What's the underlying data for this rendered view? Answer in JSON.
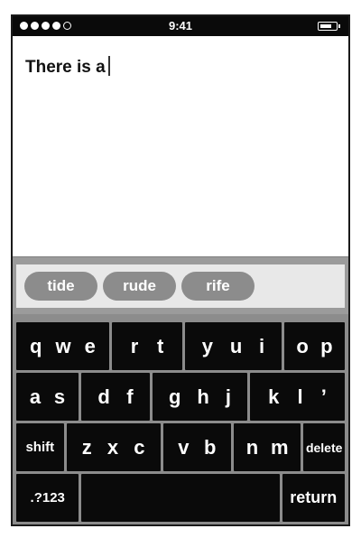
{
  "status": {
    "time": "9:41"
  },
  "editor": {
    "text": "There is a"
  },
  "suggestions": [
    "tide",
    "rude",
    "rife"
  ],
  "keyboard": {
    "row1": [
      [
        "q",
        "w",
        "e"
      ],
      [
        "r",
        "t"
      ],
      [
        "y",
        "u",
        "i"
      ],
      [
        "o",
        "p"
      ]
    ],
    "row2": [
      [
        "a",
        "s"
      ],
      [
        "d",
        "f"
      ],
      [
        "g",
        "h",
        "j"
      ],
      [
        "k",
        "l",
        "’"
      ]
    ],
    "row3": {
      "shift": "shift",
      "keys": [
        [
          "z",
          "x",
          "c"
        ],
        [
          "v",
          "b"
        ],
        [
          "n",
          "m"
        ]
      ],
      "delete": "delete"
    },
    "row4": {
      "numbers": ".?123",
      "space": "",
      "return": "return"
    }
  },
  "colors": {
    "key": "#0a0a0a",
    "keyboard_bg": "#8c8c8c",
    "pill": "#8c8c8c",
    "suggest_bg": "#e8e8e8"
  }
}
